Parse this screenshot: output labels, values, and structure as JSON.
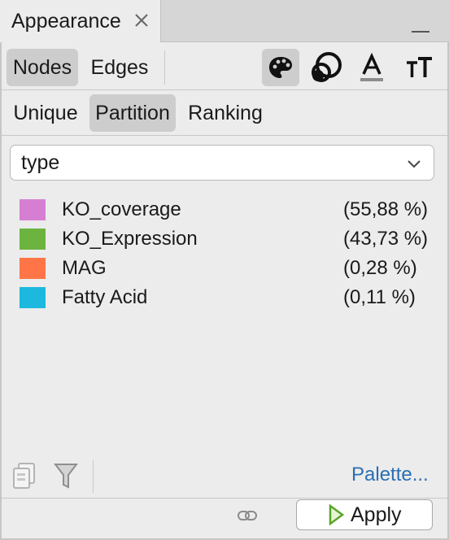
{
  "window": {
    "tab_title": "Appearance",
    "close_icon": "close-icon",
    "minimize_icon": "minimize-icon"
  },
  "element_tabs": [
    {
      "label": "Nodes",
      "active": true
    },
    {
      "label": "Edges",
      "active": false
    }
  ],
  "toolbar_icons": [
    "palette-icon",
    "node-size-icon",
    "label-color-icon",
    "label-size-icon"
  ],
  "mode_tabs": [
    {
      "label": "Unique",
      "active": false
    },
    {
      "label": "Partition",
      "active": true
    },
    {
      "label": "Ranking",
      "active": false
    }
  ],
  "attribute_select": {
    "value": "type"
  },
  "partitions": [
    {
      "label": "KO_coverage",
      "percent": "(55,88 %)",
      "color": "#d67fd2"
    },
    {
      "label": "KO_Expression",
      "percent": "(43,73 %)",
      "color": "#6cb33f"
    },
    {
      "label": "MAG",
      "percent": "(0,28 %)",
      "color": "#ff7547"
    },
    {
      "label": "Fatty Acid",
      "percent": "(0,11 %)",
      "color": "#1cb8dd"
    }
  ],
  "bottom_bar": {
    "icons": [
      "copy-icon",
      "filter-icon",
      "link-icon"
    ],
    "palette_link": "Palette...",
    "apply_label": "Apply"
  }
}
